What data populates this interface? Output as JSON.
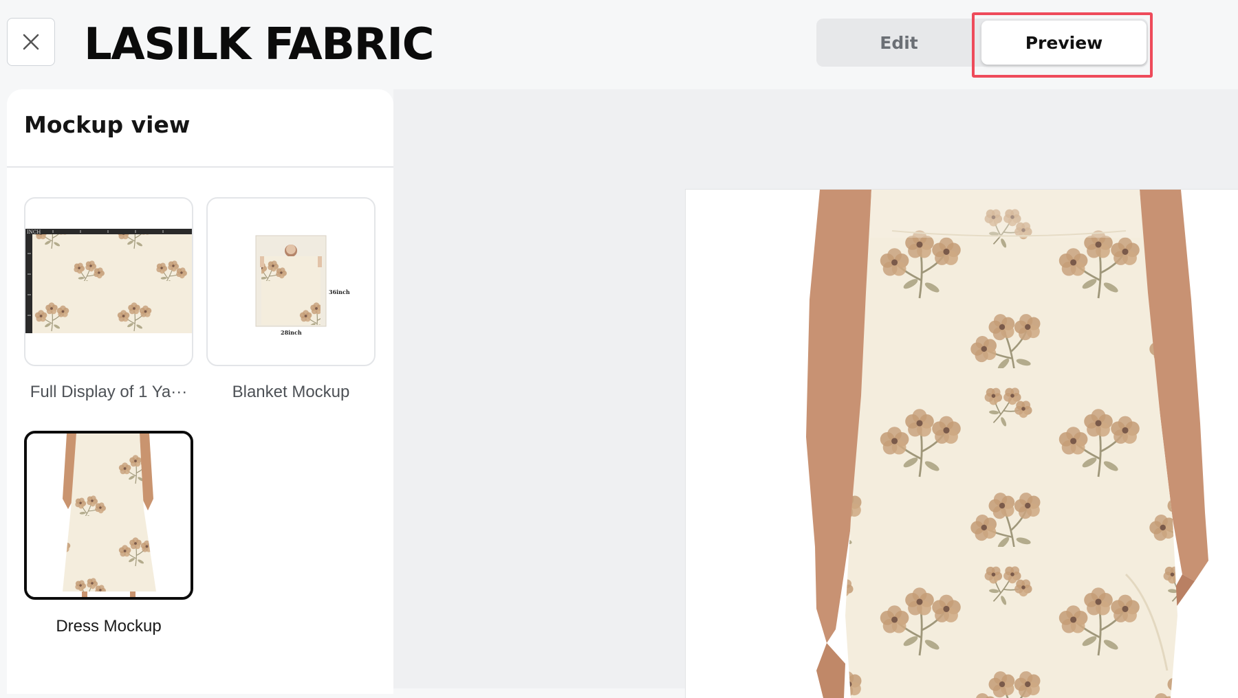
{
  "header": {
    "title": "LASILK FABRIC",
    "close_icon": "close-icon",
    "tabs": [
      {
        "label": "Edit",
        "active": false
      },
      {
        "label": "Preview",
        "active": true
      }
    ]
  },
  "sidebar": {
    "title": "Mockup view",
    "mockups": [
      {
        "label": "Full Display of 1 Ya···",
        "selected": false,
        "ruler_text": "INCH"
      },
      {
        "label": "Blanket Mockup",
        "selected": false,
        "height_text": "36inch",
        "width_text": "28inch"
      },
      {
        "label": "Dress Mockup",
        "selected": true
      }
    ]
  },
  "colors": {
    "highlight": "#ee4b5b",
    "fabric_cream": "#f4eddd",
    "flower_tan": "#c9a47f",
    "leaf_olive": "#a89f7f"
  }
}
